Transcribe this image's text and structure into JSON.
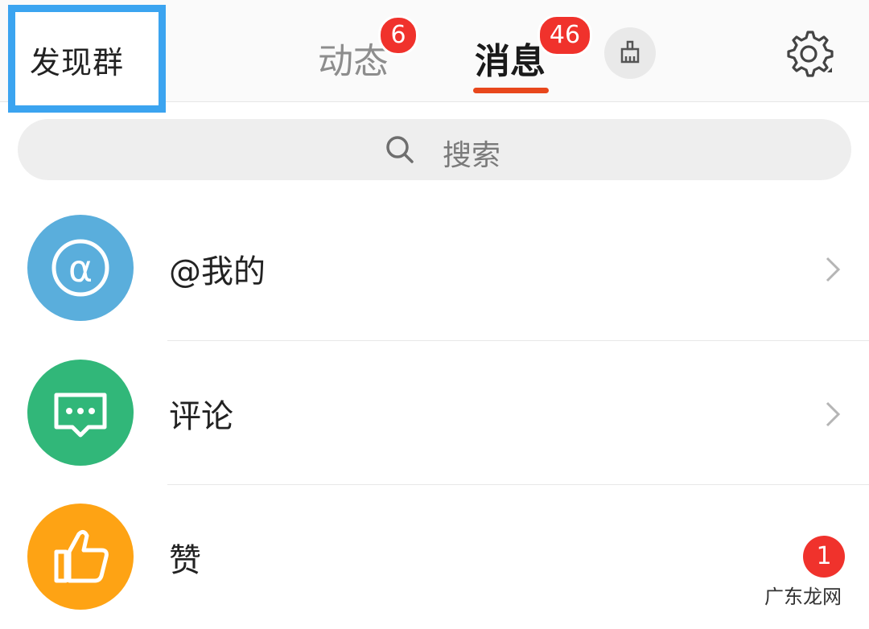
{
  "header": {
    "discover_label": "发现群",
    "tabs": [
      {
        "label": "动态",
        "badge": "6",
        "active": false
      },
      {
        "label": "消息",
        "badge": "46",
        "active": true
      }
    ]
  },
  "search": {
    "placeholder": "搜索"
  },
  "items": [
    {
      "label": "@我的",
      "icon": "at-icon",
      "color": "#5aaedc",
      "has_chevron": true
    },
    {
      "label": "评论",
      "icon": "comment-icon",
      "color": "#31b779",
      "has_chevron": true
    },
    {
      "label": "赞",
      "icon": "thumbs-up-icon",
      "color": "#fea314",
      "badge": "1",
      "has_chevron": false
    }
  ],
  "watermark": "广东龙网",
  "colors": {
    "accent": "#e8471c",
    "badge": "#f0322c",
    "highlight_box": "#3ba4f0"
  }
}
